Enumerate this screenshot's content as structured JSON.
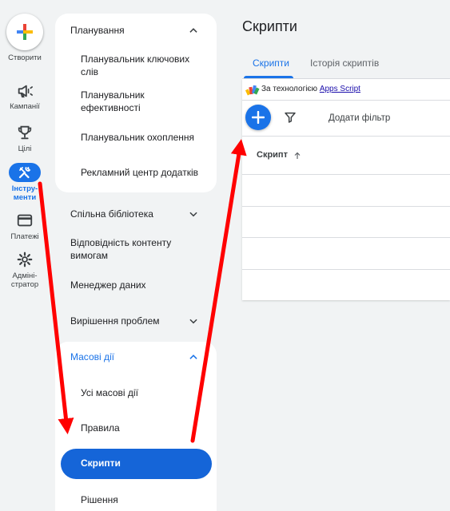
{
  "rail": {
    "create_label": "Створити",
    "items": [
      {
        "label": "Кампанії",
        "icon": "megaphone-icon"
      },
      {
        "label": "Цілі",
        "icon": "trophy-icon"
      },
      {
        "label": "Інстру-",
        "label2": "менти",
        "icon": "tools-icon",
        "active": true
      },
      {
        "label": "Платежі",
        "icon": "credit-card-icon"
      },
      {
        "label": "Адміні-",
        "label2": "стратор",
        "icon": "gear-icon"
      }
    ]
  },
  "nav": {
    "planning": "Планування",
    "planning_items": [
      "Планувальник ключових слів",
      "Планувальник ефективності",
      "Планувальник охоплення",
      "Рекламний центр додатків"
    ],
    "shared_library": "Спільна бібліотека",
    "content_compliance": "Відповідність контенту вимогам",
    "data_manager": "Менеджер даних",
    "troubleshooting": "Вирішення проблем",
    "bulk_actions": "Масові дії",
    "bulk_items": [
      "Усі масові дії",
      "Правила",
      "Скрипти",
      "Рішення"
    ]
  },
  "main": {
    "title": "Скрипти",
    "tabs": [
      "Скрипти",
      "Історія скриптів"
    ],
    "powered_by": "За технологією",
    "apps_script_link": "Apps Script",
    "add_filter": "Додати фільтр",
    "column_header": "Скрипт"
  },
  "colors": {
    "accent": "#1a73e8",
    "annotation_arrow": "#ff0000"
  }
}
